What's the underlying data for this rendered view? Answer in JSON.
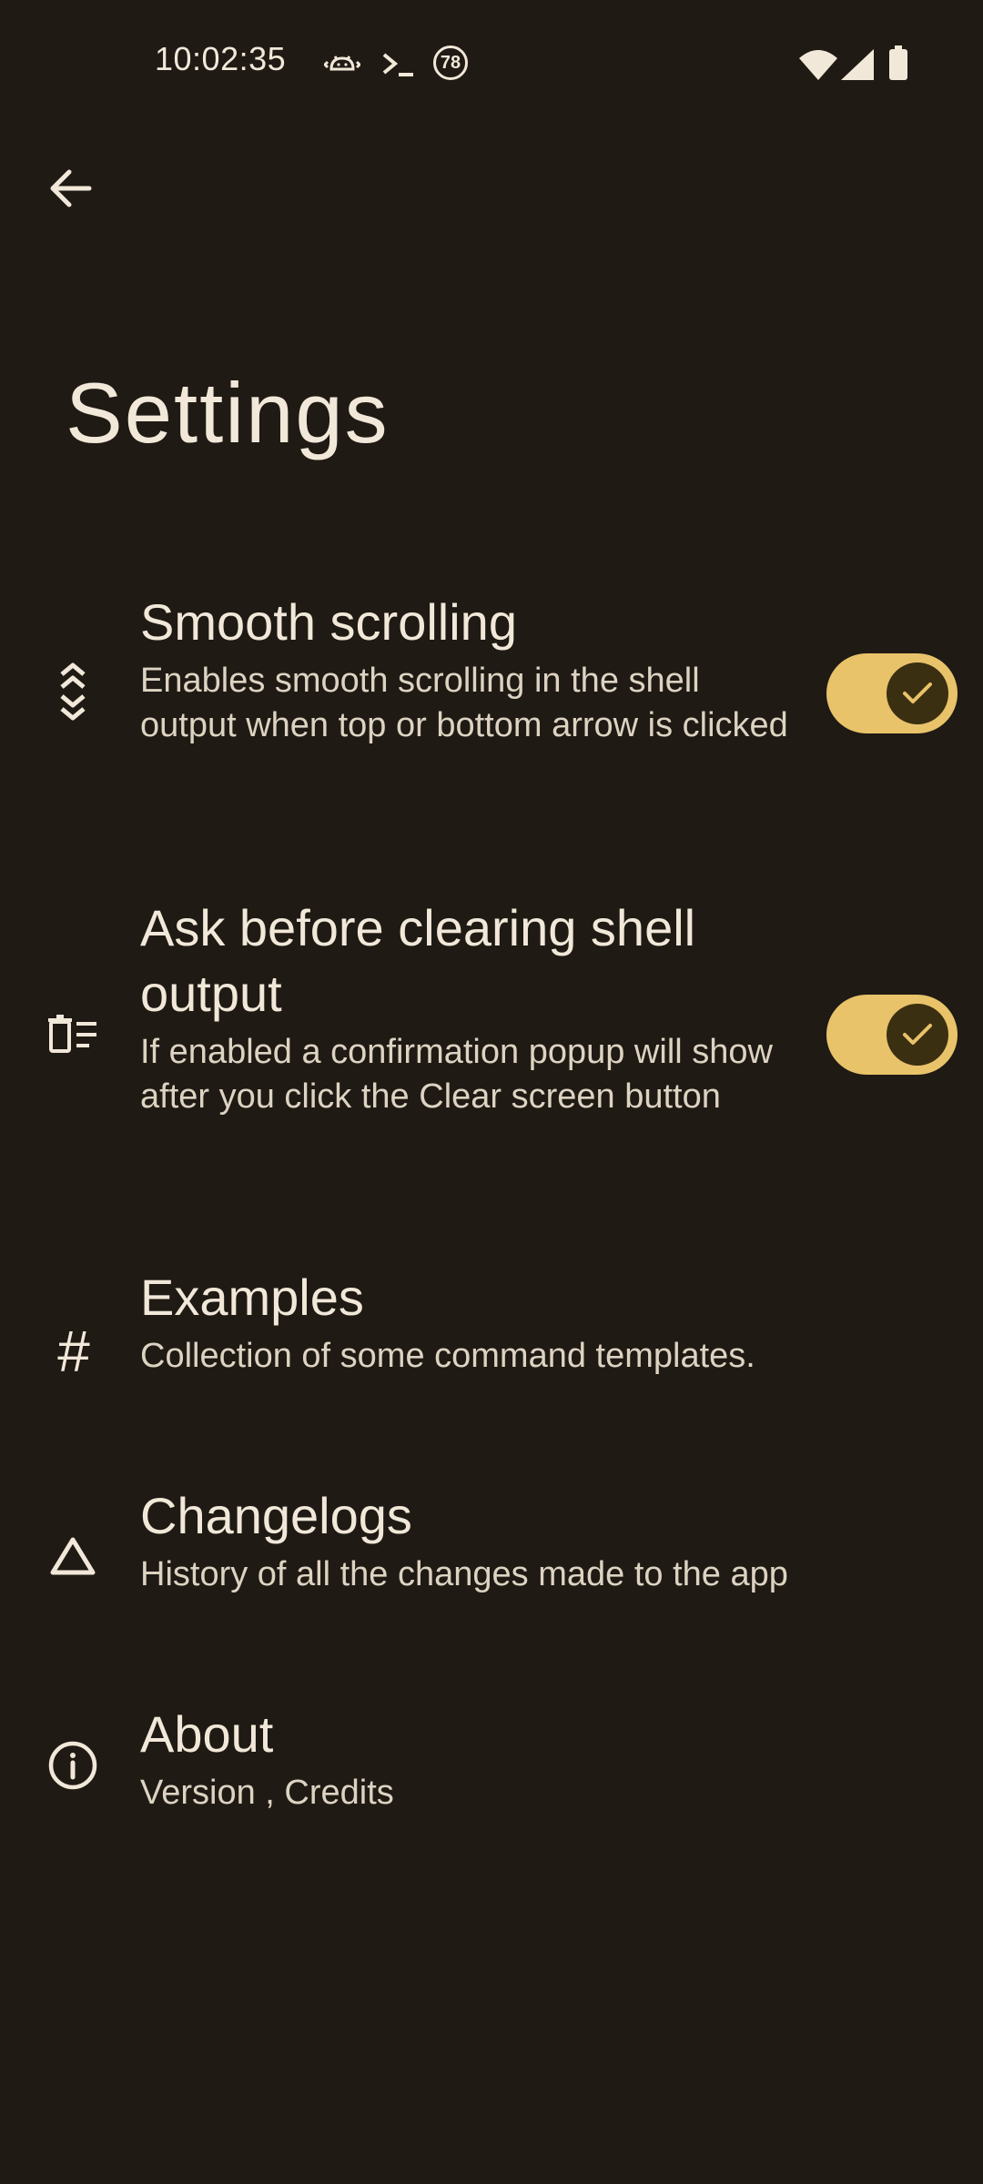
{
  "status_bar": {
    "time": "10:02:35",
    "notification_badge": "78",
    "network_type": "4"
  },
  "header": {
    "back_icon": "arrow-back-icon",
    "title": "Settings"
  },
  "settings": [
    {
      "icon": "smooth-scroll-icon",
      "title": "Smooth scrolling",
      "subtitle": "Enables smooth scrolling in the shell output when top or bottom arrow is clicked",
      "toggle": true
    },
    {
      "icon": "clear-list-icon",
      "title": "Ask before clearing shell output",
      "subtitle": "If enabled a confirmation popup will show after you click the Clear screen button",
      "toggle": true
    },
    {
      "icon": "hash-icon",
      "title": "Examples",
      "subtitle": "Collection of some command templates."
    },
    {
      "icon": "triangle-icon",
      "title": "Changelogs",
      "subtitle": "History of all the changes made to the app"
    },
    {
      "icon": "info-icon",
      "title": "About",
      "subtitle": "Version , Credits"
    }
  ],
  "colors": {
    "background": "#1f1a14",
    "text": "#f1e8d9",
    "accent": "#e9c36a",
    "thumb": "#3b2f12"
  }
}
